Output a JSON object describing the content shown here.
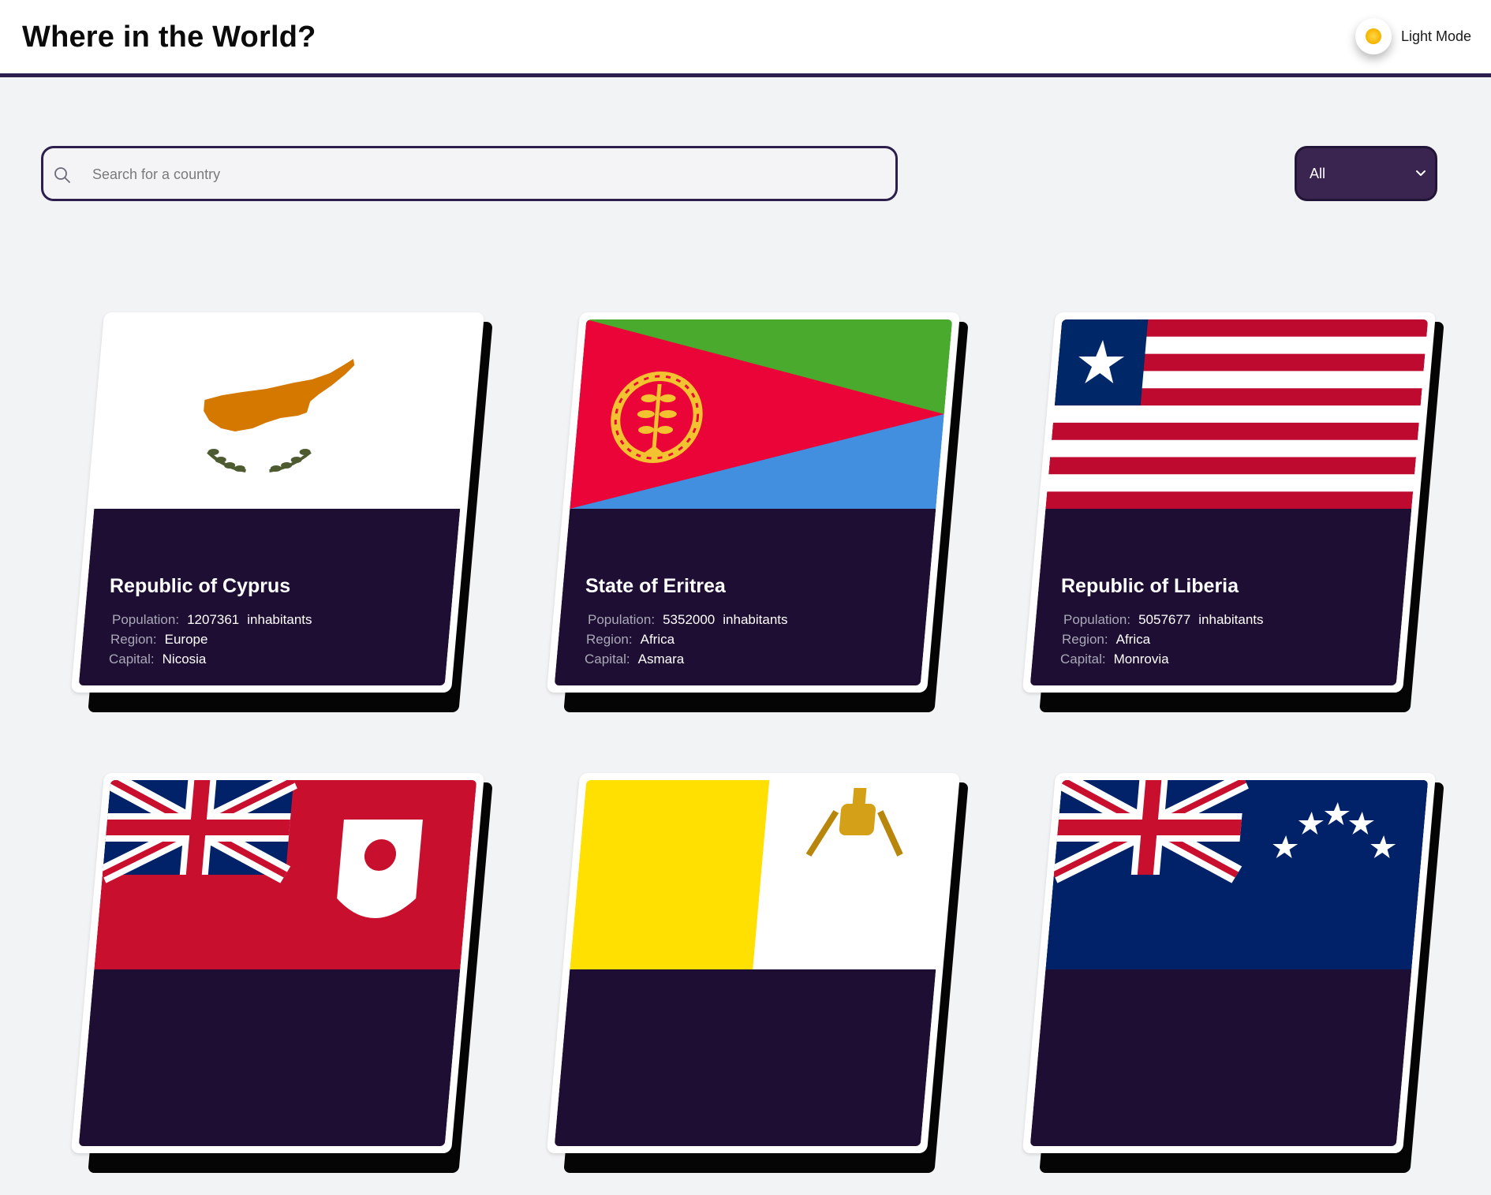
{
  "header": {
    "title": "Where in the World?",
    "theme_toggle_label": "Light Mode",
    "theme_icon": "sun-icon"
  },
  "search": {
    "placeholder": "Search for a country",
    "value": "",
    "icon": "search-icon"
  },
  "region_filter": {
    "selected": "All",
    "icon": "chevron-down-icon"
  },
  "labels": {
    "population": "Population:",
    "region": "Region:",
    "capital": "Capital:",
    "unit": "inhabitants"
  },
  "countries": [
    {
      "name": "Republic of Cyprus",
      "population": "1207361",
      "region": "Europe",
      "capital": "Nicosia",
      "flag": "cyprus-flag"
    },
    {
      "name": "State of Eritrea",
      "population": "5352000",
      "region": "Africa",
      "capital": "Asmara",
      "flag": "eritrea-flag"
    },
    {
      "name": "Republic of Liberia",
      "population": "5057677",
      "region": "Africa",
      "capital": "Monrovia",
      "flag": "liberia-flag"
    },
    {
      "name": "",
      "population": "",
      "region": "",
      "capital": "",
      "flag": "bermuda-flag"
    },
    {
      "name": "",
      "population": "",
      "region": "",
      "capital": "",
      "flag": "vatican-flag"
    },
    {
      "name": "",
      "population": "",
      "region": "",
      "capital": "",
      "flag": "cook-islands-flag"
    }
  ],
  "colors": {
    "accent": "#2c1e4d",
    "card_info_bg": "#1e0e33",
    "page_bg": "#f2f3f5"
  }
}
